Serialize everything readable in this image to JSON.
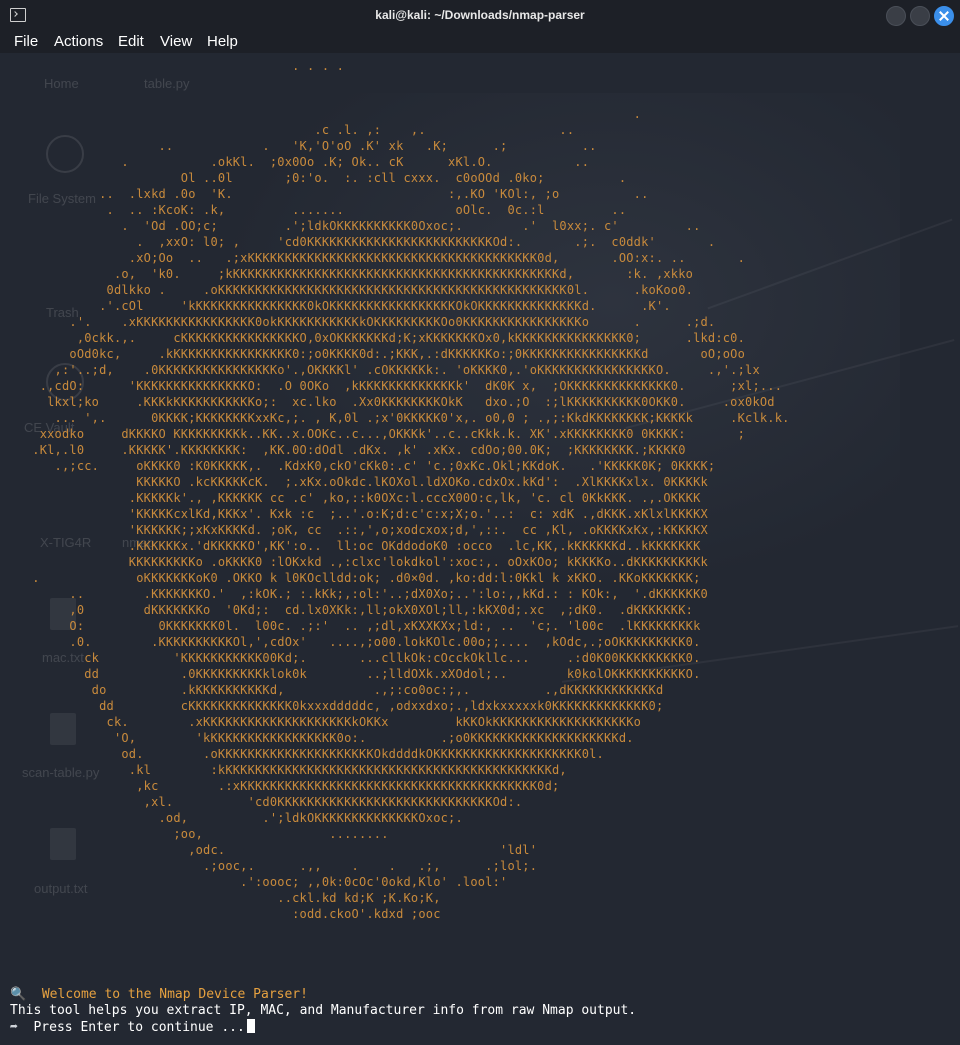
{
  "window": {
    "title": "kali@kali: ~/Downloads/nmap-parser"
  },
  "menu": {
    "file": "File",
    "actions": "Actions",
    "edit": "Edit",
    "view": "View",
    "help": "Help"
  },
  "background_desktop": {
    "labels": [
      "Home",
      "table.py",
      "File System",
      "Trash",
      "CE Vault",
      "X-TIG4R",
      "nmap",
      "mac.txt",
      "scan-table.py",
      "output.txt"
    ]
  },
  "terminal": {
    "ascii_art": "                                      . . . .\n\n\n                                                                                    .\n                                         .c .l. ,:    ,.                  ..\n                    ..            .   'K,'O'oO .K' xk   .K;      .;          ..\n               .           .okKl.  ;0x0Oo .K; Ok.. cK      xKl.O.           ..\n                       Ol ..0l       ;0:'o.  :. :cll cxxx.  c0oOOd .0ko;          .\n            ..  .lxkd .0o  'K.                             :,.KO 'KOl:, ;o          ..\n             .  .. :KcoK: .k,         .......               oOlc.  0c.:l         ..\n               .  'Od .OO;c;         .';ldkOKKKKKKKKKK0Oxoc;.        .'  l0xx;. c'         ..\n                 .  ,xxO: l0; ,     'cd0KKKKKKKKKKKKKKKKKKKKKKKKKOd:.       .;.  c0ddk'       .\n                .xO;Oo  ..   .;xKKKKKKKKKKKKKKKKKKKKKKKKKKKKKKKKKKKKKKK0d,       .OO:x:. ..       .\n              .o,  'k0.     ;kKKKKKKKKKKKKKKKKKKKKKKKKKKKKKKKKKKKKKKKKKKKKd,       :k. ,xkko\n             0dlkko .     .oKKKKKKKKKKKKKKKKKKKKKKKKKKKKKKKKKKKKKKKKKKKKKKK0l.      .koKoo0.\n            .'.cOl     'kKKKKKKKKKKKKKKK0kOKKKKKKKKKKKKKKKKKOkOKKKKKKKKKKKKKKd.      .K'.\n        .'.    .xKKKKKKKKKKKKKKKK0okKKKKKKKKKKKkOKKKKKKKKKOo0KKKKKKKKKKKKKKKKo      .      .;d.\n         ,0ckk.,.     cKKKKKKKKKKKKKKKKO,0xOKKKKKKKd;K;xKKKKKKKOx0,kKKKKKKKKKKKKKKK0;      .lkd:c0.\n        oOd0kc,     .kKKKKKKKKKKKKKKKK0:;o0KKKK0d:.;KKK,.:dKKKKKKo:;0KKKKKKKKKKKKKKKKd       oO;oOo\n      ,:'..;d,    .0KKKKKKKKKKKKKKKKo'.,OKKKKl' .cOKKKKKk:. 'oKKKK0,.'oKKKKKKKKKKKKKKKKO.     .,'.;lx\n    .,cdO:      'KKKKKKKKKKKKKKKO:  .O 0OKo  ,kKKKKKKKKKKKKKk'  dK0K x,  ;OKKKKKKKKKKKKKK0.      ;xl;...\n     lkxl;ko     .KKKkKKKKKKKKKKKo;:  xc.lko  .Xx0KKKKKKKKOkK   dxo.;O  :;lKKKKKKKKKK0OKK0.     .ox0kOd\n      ... ',.      0KKKK;KKKKKKKKxxKc,;. , K,0l .;x'0KKKKK0'x,. o0,0 ; .,;:KkdKKKKKKKK;KKKKk     .Kclk.k.\n    xxodko     dKKKKO KKKKKKKKKk..KK..x.OOKc..c...,OKKKk'..c..cKkk.k. XK'.xKKKKKKKK0 0KKKK:       ;\n   .Kl,.l0     .KKKKK'.KKKKKKKK:  ,KK.0O:dOdl .dKx. ,k' .xKx. cdOo;00.0K;  ;KKKKKKKK.;KKKK0\n      .,;cc.     oKKKK0 :K0KKKKK,.  .KdxK0,ckO'cKk0:.c' 'c.;0xKc.Okl;KKdoK.   .'KKKKK0K; 0KKKK;\n                 KKKKKO .kcKKKKKcK.  ;.xKx.oOkdc.lKOXol.ldXOKo.cdxOx.kKd':  .XlKKKKxlx. 0KKKKk\n                .KKKKKk'., ,KKKKKK cc .c' ,ko,::k0OXc:l.cccX00O:c,lk, 'c. cl 0KkKKK. .,.OKKKK\n                'KKKKKcxlKd,KKKx'. Kxk :c  ;..'.o:K;d:c'c:x;X;o.'..:  c: xdK .,dKKK.xKlxlKKKKX\n                'KKKKKK;;xKxKKKKd. ;oK, cc  .::,',o;xodcxox;d,',::.  cc ,Kl, .oKKKKxKx,:KKKKKX\n                .KKKKKKx.'dKKKKKO',KK':o..  ll:oc OKddodoK0 :occo  .lc,KK,.kKKKKKKd..kKKKKKKK\n                KKKKKKKKKo .oKKKK0 :lOKxkd .,:clxc'lokdkol':xoc:,. oOxKOo; kKKKKo..dKKKKKKKKKk\n   .             oKKKKKKKoK0 .OKKO k l0KOclldd:ok; .d0×0d. ,ko:dd:l:0Kkl k xKKO. .KKoKKKKKKK;\n        ..        .KKKKKKKO.'  ,:kOK.; :.kKk;,:ol:'..;dX0Xo;..':lo:,,kKd.: : KOk:,  '.dKKKKKK0\n        ,0        dKKKKKKKo  '0Kd;:  cd.lx0XKk:,ll;okX0XOl;ll,:kKX0d;.xc  ,;dK0.  .dKKKKKKK:\n        O:          0KKKKKKK0l.  l00c. .;:'  .. ,;dl,xKXXKXx;ld:, ..  'c;. 'l00c  .lKKKKKKKKk\n        .0.        .KKKKKKKKKKOl,',cdOx'   ....,;o00.lokKOlc.00o;;....  ,kOdc,.;oOKKKKKKKKK0.\n          ck          'KKKKKKKKKKK00Kd;.       ...cllkOk:cOcckOkllc...     .:d0K00KKKKKKKKK0.\n          dd           .0KKKKKKKKKklok0k        ..;lldOXk.xXOdol;..        k0kolOKKKKKKKKKKO.\n           do          .kKKKKKKKKKKd,            .,;:co0oc:;,.          .,dKKKKKKKKKKKKd\n            dd         cKKKKKKKKKKKKKK0kxxxdddddc, ,odxxdxo;.,ldxkxxxxxk0KKKKKKKKKKKKK0;\n             ck.        .xKKKKKKKKKKKKKKKKKKKKkOKKx         kKKOkKKKKKKKKKKKKKKKKKKKo\n              'O,        'kKKKKKKKKKKKKKKKKK0o:.          .;o0KKKKKKKKKKKKKKKKKKKKd.\n               od.        .oKKKKKKKKKKKKKKKKKKKKKOkddddkOKKKKKKKKKKKKKKKKKKKK0l.\n                .kl        :kKKKKKKKKKKKKKKKKKKKKKKKKKKKKKKKKKKKKKKKKKKKKd,\n                 ,kc        .:xKKKKKKKKKKKKKKKKKKKKKKKKKKKKKKKKKKKKKKKK0d;\n                  ,xl.          'cd0KKKKKKKKKKKKKKKKKKKKKKKKKKKKKOd:.\n                    .od,          .';ldkOKKKKKKKKKKKKKKOxoc;.\n                      ;oo,                 ........\n                        ,odc.                                     'ldl'\n                          .;ooc,.      .,,    .    .   .;,      .;lol;.\n                               .':oooc; ,,0k:0cOc'0okd,Klo' .lool:'\n                                    ..ckl.kd kd;K ;K.Ko;K,\n                                      :odd.ckoO'.kdxd ;ooc",
    "welcome_icon": "🔍",
    "welcome_text": "Welcome to the Nmap Device Parser!",
    "description": "This tool helps you extract IP, MAC, and Manufacturer info from raw Nmap output.",
    "prompt_icon": "➦",
    "prompt_text": "Press Enter to continue ..."
  },
  "colors": {
    "ascii": "#c88a3c",
    "welcome": "#e6a140",
    "text": "#ffffff",
    "close_button": "#3b8fea"
  }
}
